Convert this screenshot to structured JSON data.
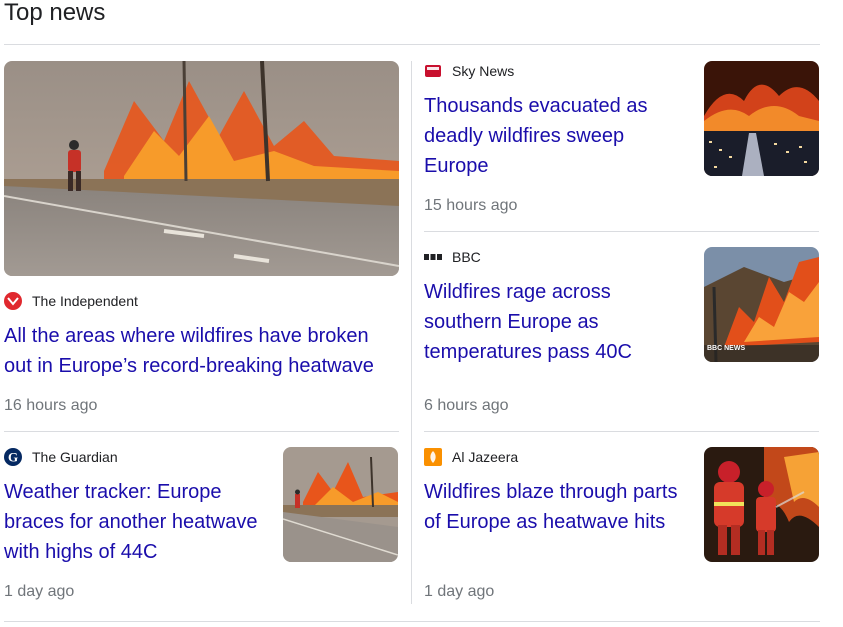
{
  "section": {
    "title": "Top news"
  },
  "stories": [
    {
      "source": "The Independent",
      "title": "All the areas where wildfires have broken out in Europe’s record-breaking heatwave",
      "time": "16 hours ago",
      "logo_color": "#e0282e"
    },
    {
      "source": "Sky News",
      "title": "Thousands evacuated as deadly wildfires sweep Europe",
      "time": "15 hours ago",
      "logo_color": "#c8102e"
    },
    {
      "source": "BBC",
      "title": "Wildfires rage across southern Europe as temperatures pass 40C",
      "time": "6 hours ago",
      "thumb_watermark": "BBC NEWS"
    },
    {
      "source": "The Guardian",
      "title": "Weather tracker: Europe braces for another heatwave with highs of 44C",
      "time": "1 day ago",
      "logo_color": "#052962"
    },
    {
      "source": "Al Jazeera",
      "title": "Wildfires blaze through parts of Europe as heatwave hits",
      "time": "1 day ago",
      "logo_color": "#fa9000"
    }
  ],
  "colors": {
    "link": "#1a0dab",
    "meta": "#70757a",
    "divider": "#dadce0"
  }
}
